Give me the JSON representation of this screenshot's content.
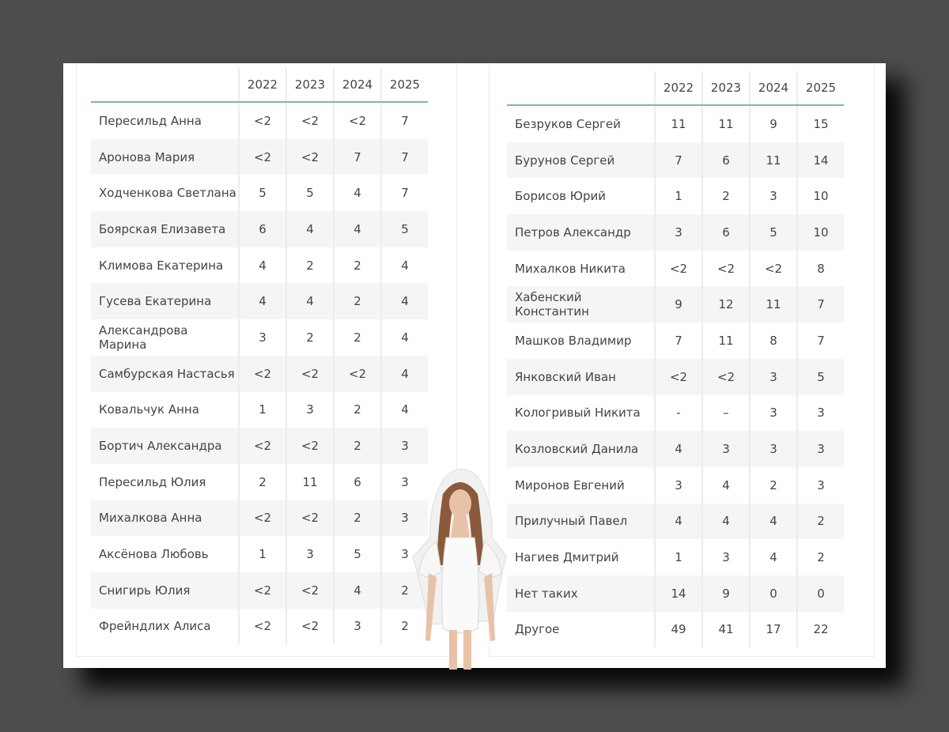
{
  "left_table": {
    "years": [
      "2022",
      "2023",
      "2024",
      "2025"
    ],
    "rows": [
      {
        "name": "Пересильд Анна",
        "values": [
          "<2",
          "<2",
          "<2",
          "7"
        ]
      },
      {
        "name": "Аронова Мария",
        "values": [
          "<2",
          "<2",
          "7",
          "7"
        ]
      },
      {
        "name": "Ходченкова Светлана",
        "values": [
          "5",
          "5",
          "4",
          "7"
        ]
      },
      {
        "name": "Боярская Елизавета",
        "values": [
          "6",
          "4",
          "4",
          "5"
        ]
      },
      {
        "name": "Климова Екатерина",
        "values": [
          "4",
          "2",
          "2",
          "4"
        ]
      },
      {
        "name": "Гусева Екатерина",
        "values": [
          "4",
          "4",
          "2",
          "4"
        ]
      },
      {
        "name": "Александрова Марина",
        "values": [
          "3",
          "2",
          "2",
          "4"
        ]
      },
      {
        "name": "Самбурская Настасья",
        "values": [
          "<2",
          "<2",
          "<2",
          "4"
        ]
      },
      {
        "name": "Ковальчук Анна",
        "values": [
          "1",
          "3",
          "2",
          "4"
        ]
      },
      {
        "name": "Бортич Александра",
        "values": [
          "<2",
          "<2",
          "2",
          "3"
        ]
      },
      {
        "name": "Пересильд Юлия",
        "values": [
          "2",
          "11",
          "6",
          "3"
        ]
      },
      {
        "name": "Михалкова Анна",
        "values": [
          "<2",
          "<2",
          "2",
          "3"
        ]
      },
      {
        "name": "Аксёнова Любовь",
        "values": [
          "1",
          "3",
          "5",
          "3"
        ]
      },
      {
        "name": "Снигирь Юлия",
        "values": [
          "<2",
          "<2",
          "4",
          "2"
        ]
      },
      {
        "name": "Фрейндлих Алиса",
        "values": [
          "<2",
          "<2",
          "3",
          "2"
        ]
      }
    ]
  },
  "right_table": {
    "years": [
      "2022",
      "2023",
      "2024",
      "2025"
    ],
    "rows": [
      {
        "name": "Безруков Сергей",
        "values": [
          "11",
          "11",
          "9",
          "15"
        ]
      },
      {
        "name": "Бурунов Сергей",
        "values": [
          "7",
          "6",
          "11",
          "14"
        ]
      },
      {
        "name": "Борисов Юрий",
        "values": [
          "1",
          "2",
          "3",
          "10"
        ]
      },
      {
        "name": "Петров Александр",
        "values": [
          "3",
          "6",
          "5",
          "10"
        ]
      },
      {
        "name": "Михалков Никита",
        "values": [
          "<2",
          "<2",
          "<2",
          "8"
        ]
      },
      {
        "name": "Хабенский Константин",
        "values": [
          "9",
          "12",
          "11",
          "7"
        ]
      },
      {
        "name": "Машков Владимир",
        "values": [
          "7",
          "11",
          "8",
          "7"
        ]
      },
      {
        "name": "Янковский Иван",
        "values": [
          "<2",
          "<2",
          "3",
          "5"
        ]
      },
      {
        "name": "Кологривый Никита",
        "values": [
          "-",
          "–",
          "3",
          "3"
        ]
      },
      {
        "name": "Козловский Данила",
        "values": [
          "4",
          "3",
          "3",
          "3"
        ]
      },
      {
        "name": "Миронов Евгений",
        "values": [
          "3",
          "4",
          "2",
          "3"
        ]
      },
      {
        "name": "Прилучный Павел",
        "values": [
          "4",
          "4",
          "4",
          "2"
        ]
      },
      {
        "name": "Нагиев Дмитрий",
        "values": [
          "1",
          "3",
          "4",
          "2"
        ]
      },
      {
        "name": "Нет таких",
        "values": [
          "14",
          "9",
          "0",
          "0"
        ]
      },
      {
        "name": "Другое",
        "values": [
          "49",
          "41",
          "17",
          "22"
        ]
      }
    ]
  },
  "colors": {
    "background": "#4d4d4d",
    "sheet": "#ffffff",
    "header_rule": "#7fb7b4",
    "row_alt": "#f5f5f5"
  }
}
